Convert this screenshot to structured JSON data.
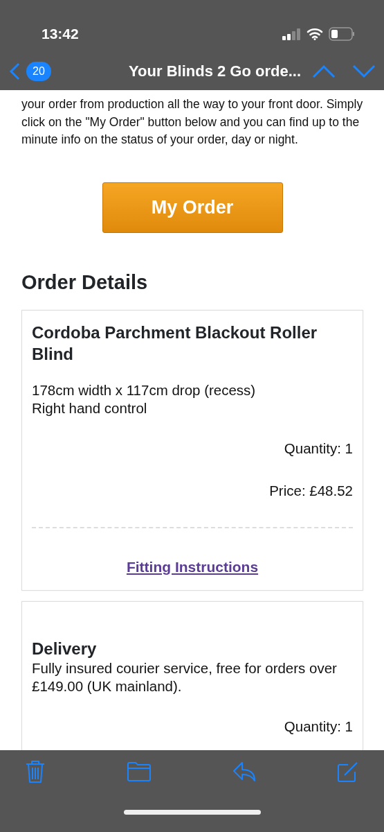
{
  "status_bar": {
    "time": "13:42"
  },
  "nav": {
    "unread_count": "20",
    "title": "Your Blinds 2 Go orde..."
  },
  "intro": "your order from production all the way to your front door. Simply click on the \"My Order\" button below and you can find up to the minute info on the status of your order, day or night.",
  "order_button": "My Order",
  "section_title": "Order Details",
  "items": [
    {
      "kind": "product",
      "name": "Cordoba Parchment Blackout Roller Blind",
      "details": [
        "178cm width x 117cm drop (recess)",
        "Right hand control"
      ],
      "quantity": "Quantity: 1",
      "price": "Price: £48.52",
      "link": "Fitting Instructions"
    },
    {
      "kind": "delivery",
      "name": "Delivery",
      "details": [
        "Fully insured courier service, free for orders over £149.00 (UK mainland)."
      ],
      "quantity": "Quantity: 1"
    }
  ]
}
